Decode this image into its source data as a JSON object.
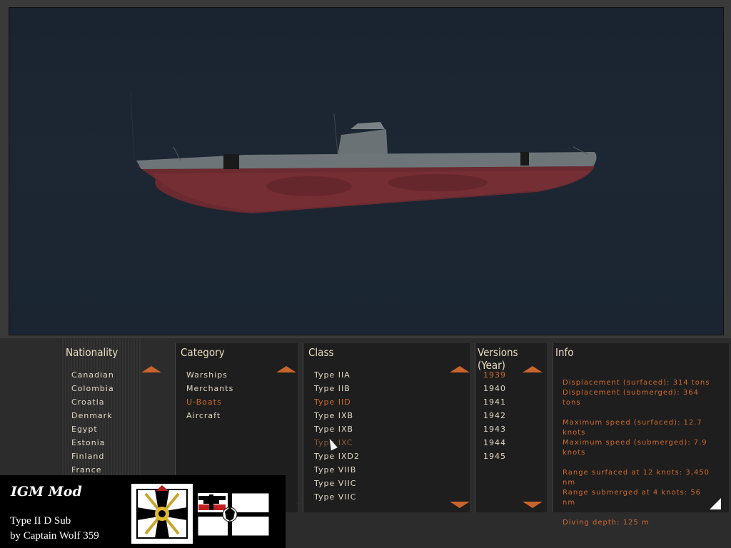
{
  "nationality": {
    "title": "Nationality",
    "items": [
      "Canadian",
      "Colombia",
      "Croatia",
      "Denmark",
      "Egypt",
      "Estonia",
      "Finland",
      "France"
    ]
  },
  "category": {
    "title": "Category",
    "items": [
      "Warships",
      "Merchants",
      "U-Boats",
      "Aircraft"
    ],
    "selected_index": 2
  },
  "class": {
    "title": "Class",
    "items": [
      "Type IIA",
      "Type IIB",
      "Type IID",
      "Type IXB",
      "Type IXB",
      "Type IXC",
      "Type IXD2",
      "Type VIIB",
      "Type VIIC",
      "Type VIIC"
    ],
    "selected_index": 2,
    "hover_index": 5
  },
  "versions": {
    "title": "Versions (Year)",
    "items": [
      "1939",
      "1940",
      "1941",
      "1942",
      "1943",
      "1944",
      "1945"
    ],
    "selected_index": 0
  },
  "info": {
    "title": "Info",
    "paragraphs": [
      "Displacement (surfaced): 314 tons\nDisplacement (submerged): 364 tons",
      "Maximum speed (surfaced): 12.7 knots\nMaximum speed (submerged): 7.9 knots",
      "Range surfaced at 12 knots: 3,450 nm\nRange submerged at 4 knots: 56 nm",
      "Diving depth: 125 m"
    ]
  },
  "overlay": {
    "mod_name": "IGM Mod",
    "line1": "Type II D Sub",
    "line2": "by Captain Wolf 359"
  },
  "colors": {
    "accent": "#d06a30",
    "text": "#e0d8c8",
    "panel_bg": "#1e1e1e"
  },
  "icons": [
    "scroll-up-arrow",
    "scroll-down-arrow",
    "resize-corner-icon",
    "mouse-cursor-icon",
    "iron-cross-flag",
    "reich-war-flag"
  ]
}
